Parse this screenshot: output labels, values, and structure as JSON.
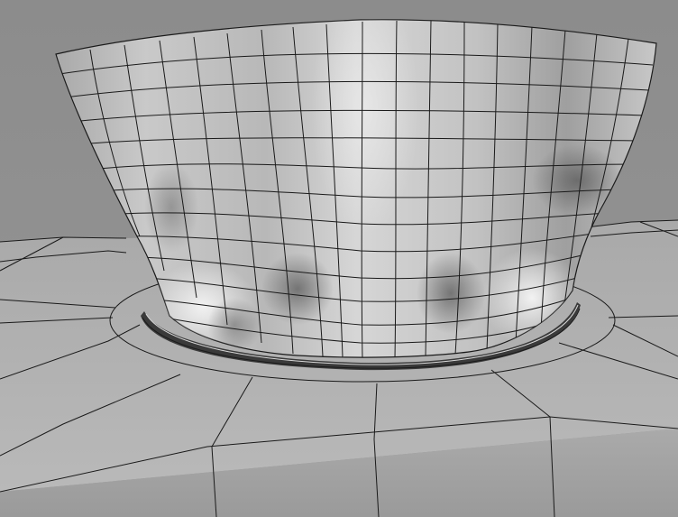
{
  "scene": {
    "subject": "wireframe-render-tissue-box",
    "colors": {
      "background": "#8f8f8f",
      "box_top": "#b3b3b3",
      "box_front": "#a6a6a6",
      "tissue_light": "#dcdcdc",
      "tissue_mid": "#bdbdbd",
      "tissue_shadow": "#6f6f6f",
      "wire": "#1a1a1a"
    }
  }
}
